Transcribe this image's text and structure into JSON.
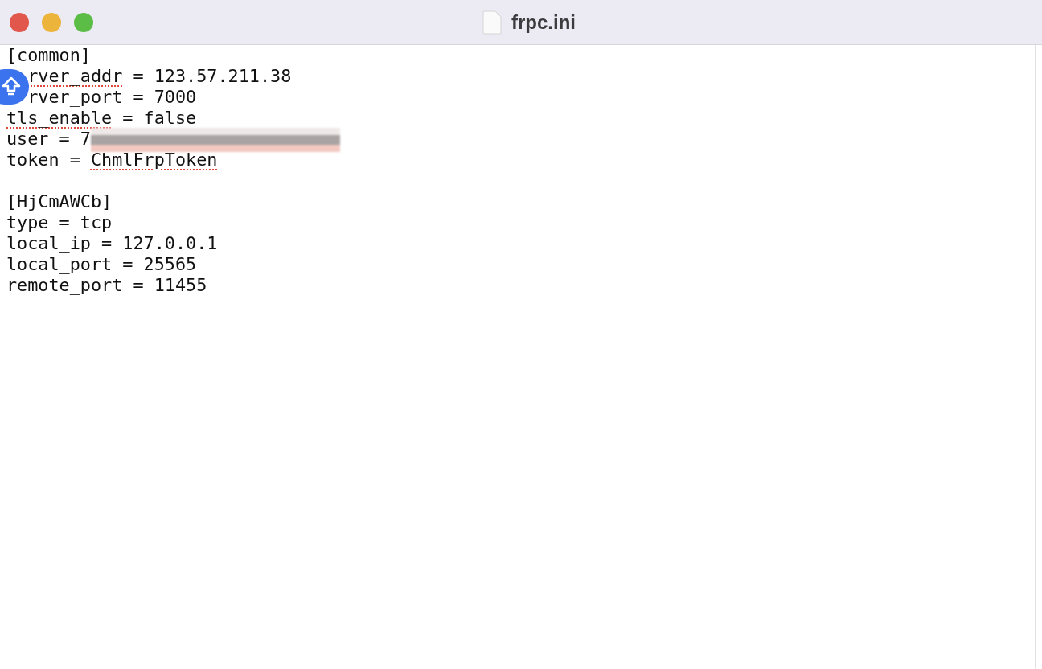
{
  "window": {
    "title": "frpc.ini"
  },
  "lines": [
    {
      "kind": "text",
      "covered": false,
      "segments": [
        {
          "text": "[common]",
          "misspelled": false
        }
      ]
    },
    {
      "kind": "text",
      "covered": true,
      "segments": [
        {
          "text": "rver_addr",
          "misspelled": true
        },
        {
          "text": " = 123.57.211.38",
          "misspelled": false
        }
      ]
    },
    {
      "kind": "text",
      "covered": true,
      "segments": [
        {
          "text": "rver_port = 7000",
          "misspelled": false
        }
      ]
    },
    {
      "kind": "text",
      "covered": false,
      "segments": [
        {
          "text": "tls_enable",
          "misspelled": true
        },
        {
          "text": " = false",
          "misspelled": false
        }
      ]
    },
    {
      "kind": "text",
      "covered": false,
      "redacted": true,
      "segments": [
        {
          "text": "user = 7",
          "misspelled": false
        }
      ]
    },
    {
      "kind": "text",
      "covered": false,
      "segments": [
        {
          "text": "token = ",
          "misspelled": false
        },
        {
          "text": "ChmlFrpToken",
          "misspelled": true
        }
      ]
    },
    {
      "kind": "blank"
    },
    {
      "kind": "text",
      "covered": false,
      "segments": [
        {
          "text": "[HjCmAWCb]",
          "misspelled": false
        }
      ]
    },
    {
      "kind": "text",
      "covered": false,
      "segments": [
        {
          "text": "type = tcp",
          "misspelled": false
        }
      ]
    },
    {
      "kind": "text",
      "covered": false,
      "segments": [
        {
          "text": "local_ip = 127.0.0.1",
          "misspelled": false
        }
      ]
    },
    {
      "kind": "text",
      "covered": false,
      "segments": [
        {
          "text": "local_port = 25565",
          "misspelled": false
        }
      ]
    },
    {
      "kind": "text",
      "covered": false,
      "segments": [
        {
          "text": "remote_port = 11455",
          "misspelled": false
        }
      ]
    }
  ]
}
